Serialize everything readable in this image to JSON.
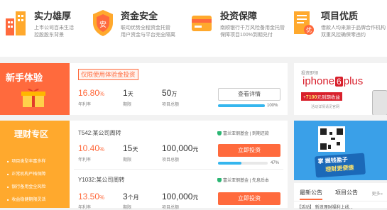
{
  "features": [
    {
      "title": "实力雄厚",
      "line1": "上市公司百未生活",
      "line2": "控股股东背景",
      "icon": "buildings-icon"
    },
    {
      "title": "资金安全",
      "line1": "联动优势全程资金托管",
      "line2": "用户资金与平台完全隔离",
      "icon": "shield-icon"
    },
    {
      "title": "投资保障",
      "line1": "南顺银行千万风险备用金托管",
      "line2": "保障项目100%到期兑付",
      "icon": "card-icon"
    },
    {
      "title": "项目优质",
      "line1": "借款人均来源于品牌合作机构",
      "line2": "双重风控确保零违约",
      "icon": "document-icon"
    }
  ],
  "newbie": {
    "label": "新手体验",
    "tag": "仅限使用体验金投资",
    "rate": "16.80",
    "rate_unit": "%",
    "rate_cap": "年利率",
    "term": "1",
    "term_unit": "天",
    "term_cap": "期限",
    "amount": "50",
    "amount_unit": "万",
    "amount_cap": "项目总额",
    "button": "查看详情",
    "progress_value": 1.0,
    "progress_text": "100%"
  },
  "finance": {
    "label": "理财专区",
    "items": [
      "项目类型丰富多样",
      "正常机构严格保障",
      "银行备用金全风险",
      "收益稳健期限灵活"
    ],
    "products": [
      {
        "name": "T542:某公司周转",
        "fund": "富兰亚钢基金",
        "fund_note": "到期还款",
        "rate": "10.40",
        "rate_unit": "%",
        "rate_cap": "年利率",
        "term": "15",
        "term_unit": "天",
        "term_cap": "期限",
        "amount": "100,000",
        "amount_unit": "元",
        "amount_cap": "项目总额",
        "button": "立即投资",
        "progress_value": 0.47,
        "progress_text": "47%"
      },
      {
        "name": "Y1032:某公司周转",
        "fund": "富兰亚钢基金",
        "fund_note": "先息后本",
        "rate": "13.50",
        "rate_unit": "%",
        "rate_cap": "年利率",
        "term": "3",
        "term_unit": "个月",
        "term_cap": "期限",
        "amount": "100,000",
        "amount_unit": "元",
        "amount_cap": "项目总额",
        "button": "立即投资"
      }
    ]
  },
  "ad_iphone": {
    "top": "投资即领",
    "brand_pre": "iphone",
    "brand_num": "6",
    "brand_post": "plus",
    "bonus_pre": "+",
    "bonus_amount": "7100",
    "bonus_post": "元到期收益",
    "bottom": "活动详情请见官网"
  },
  "ad_app": {
    "line1": "掌 握钱盈子",
    "line2": "理财更便捷"
  },
  "notice": {
    "tabs": [
      "最新公告",
      "项目公告"
    ],
    "more": "更多»",
    "first": "【活动】 新浪理财福利上线..."
  },
  "colors": {
    "accent": "#ff6a3d",
    "orange": "#ffa92d",
    "blue": "#35b6ee"
  }
}
